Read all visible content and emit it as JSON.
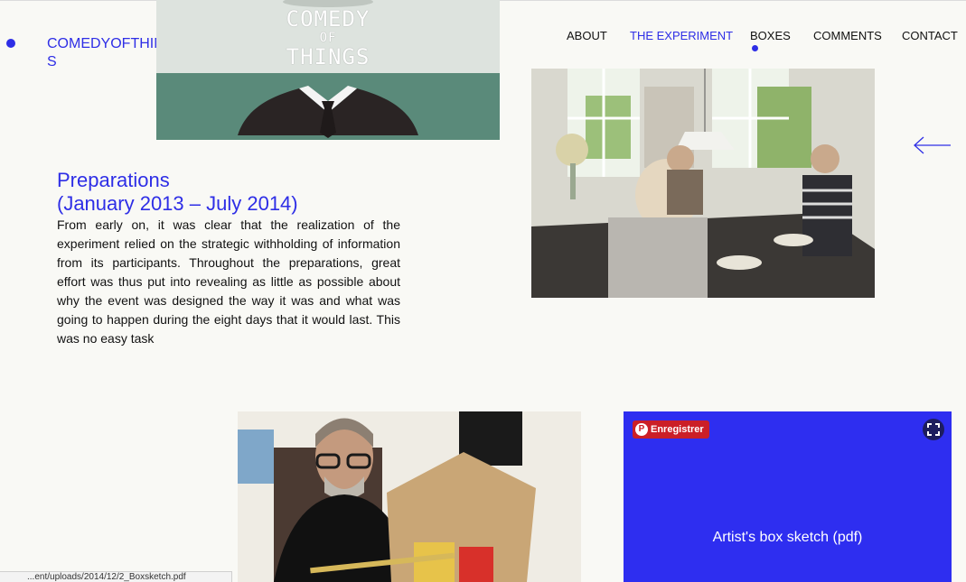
{
  "site": {
    "logo_text": "COMEDYOFTHINGS",
    "banner_title": [
      "COMEDY",
      "OF",
      "THINGS"
    ]
  },
  "nav": {
    "about": "ABOUT",
    "experiment": "THE EXPERIMENT",
    "boxes": "BOXES",
    "comments": "COMMENTS",
    "contact": "CONTACT",
    "active": "THE EXPERIMENT"
  },
  "section": {
    "title_line1": "Preparations",
    "title_line2": "(January 2013 – July 2014)",
    "body": "From early on, it was clear that the realization of the experiment relied on the strategic withholding of information from its participants. Throughout the preparations, great effort was thus put into revealing as little as possible about why the event was designed the way it was and what was going to happen during the eight days that it would last. This was no easy task"
  },
  "pdf_panel": {
    "pin_label": "Enregistrer",
    "title": "Artist's box sketch (pdf)"
  },
  "status_bar": {
    "url": "...ent/uploads/2014/12/2_Boxsketch.pdf"
  },
  "colors": {
    "accent": "#2e2ee6",
    "background": "#f9f9f5",
    "pin": "#cb1f27",
    "banner_green": "#5a8a7a"
  }
}
